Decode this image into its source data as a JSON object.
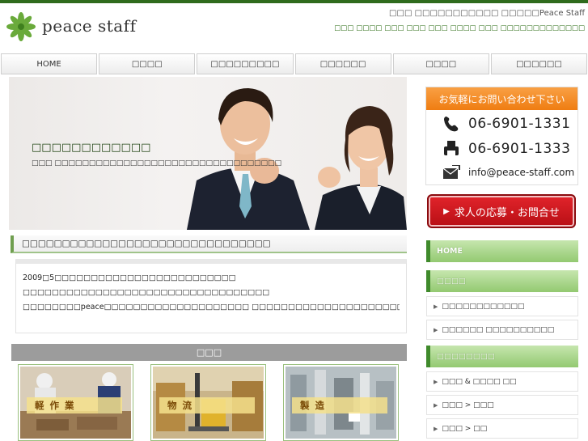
{
  "header": {
    "brand": "peace staff",
    "tagline_1": "□□□ □□□□□□□□□□□ □□□□□Peace Staff",
    "tagline_2": "□□□ □□□□ □□□ □□□ □□□ □□□□ □□□ □□□□□□□□□□□□□"
  },
  "nav": [
    "HOME",
    "□□□□",
    "□□□□□□□□□",
    "□□□□□□",
    "□□□□",
    "□□□□□□"
  ],
  "hero": {
    "title": "□□□□□□□□□□□□",
    "subtitle": "□□□ □□□□□□□□□□□□□□□□□□□□□□□□□□□□□□□□□"
  },
  "intro": {
    "heading": "□□□□□□□□□□□□□□□□□□□□□□□□□□□□□□□",
    "lines": [
      "2009□5□□□□□□□□□□□□□□□□□□□□□□□□□",
      "□□□□□□□□□□□□□□□□□□□□□□□□□□□□□□□□□□",
      "□□□□□□□□peace□□□□□□□□□□□□□□□□□□□□ □□□□□□□□□□□□□□□□□□□□□□□□□□□□□□□□□□□□□□□□□□□□□□"
    ]
  },
  "categories": {
    "heading": "□□□",
    "items": [
      {
        "label": "軽作業"
      },
      {
        "label": "物流"
      },
      {
        "label": "製造"
      }
    ]
  },
  "sidebar": {
    "contact_heading": "お気軽にお問い合わせ下さい",
    "phone": "06-6901-1331",
    "fax": "06-6901-1333",
    "email": "info@peace-staff.com",
    "apply_label": "求人の応募・お問合せ",
    "menu_home": "HOME",
    "menu_section1": "□□□□",
    "links1": [
      "□□□□□□□□□□□□",
      "□□□□□□ □□□□□□□□□□"
    ],
    "menu_section2": "□□□□□□□□",
    "links2": [
      "□□□ & □□□□ □□",
      "□□□ > □□□",
      "□□□ > □□"
    ]
  },
  "colors": {
    "brand_green": "#2f6b1d",
    "accent_orange": "#ef7d12",
    "apply_red": "#d41a21",
    "menu_green": "#93c971"
  }
}
